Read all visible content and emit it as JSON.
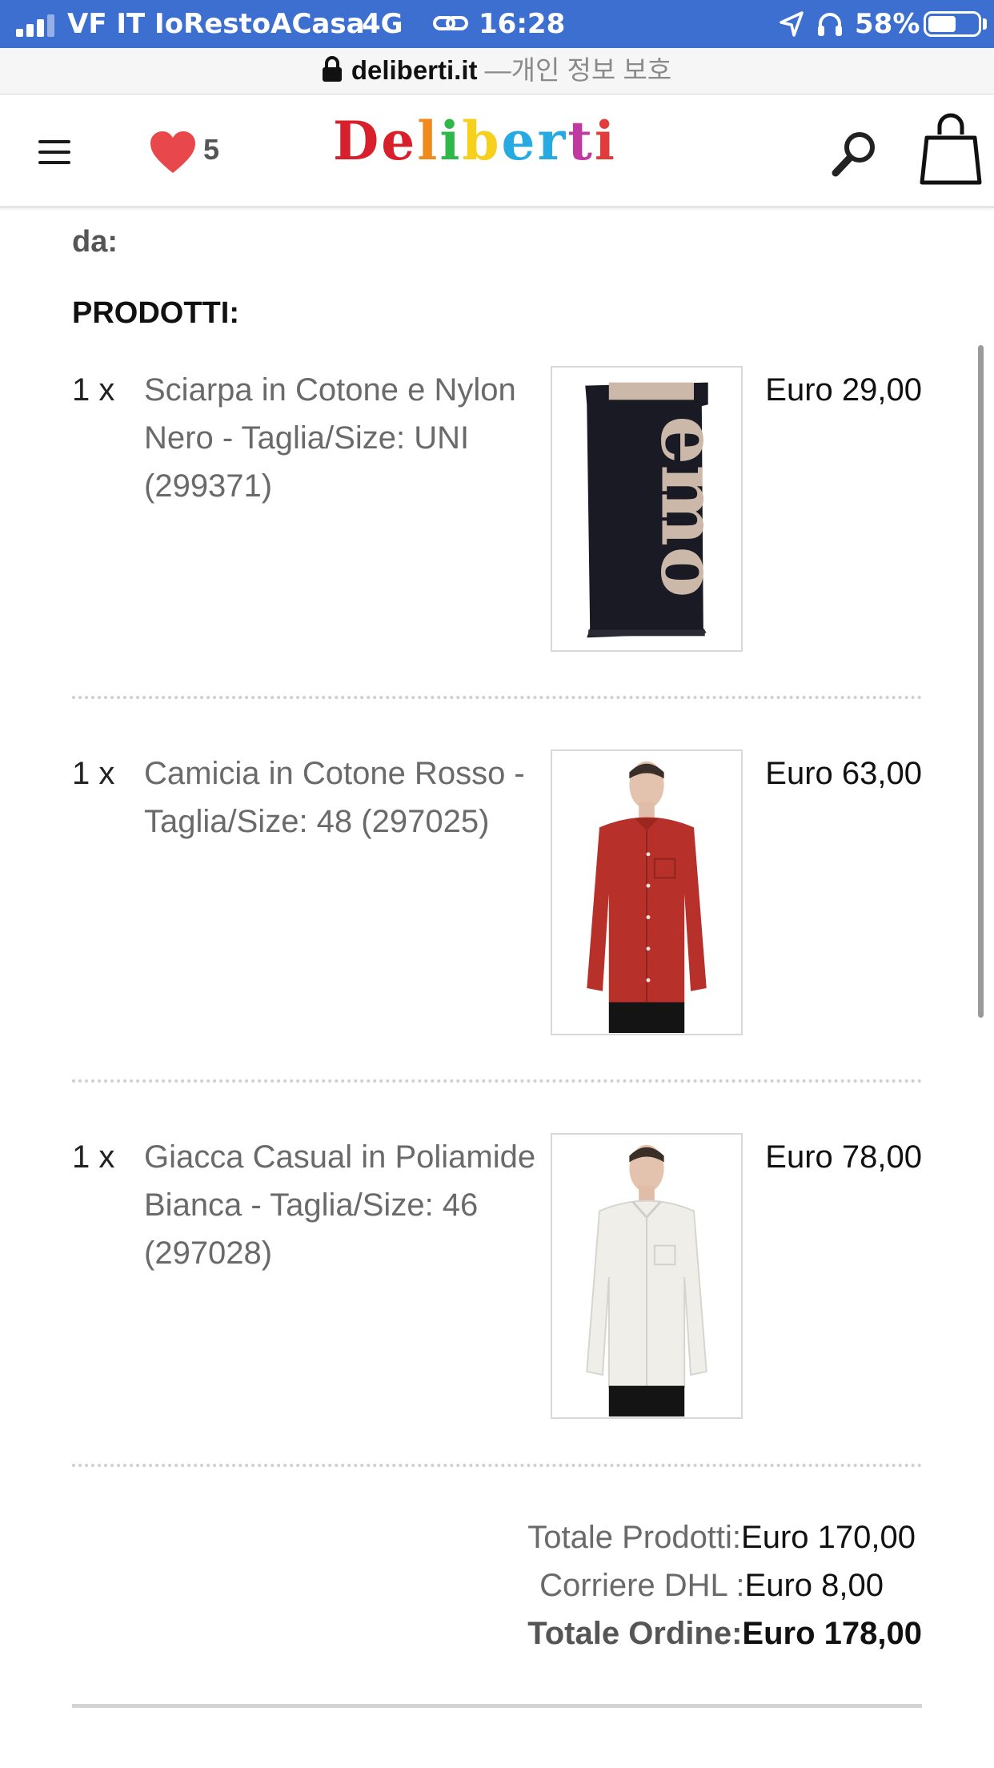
{
  "status_bar": {
    "carrier": "VF IT IoRestoACasa",
    "network": "4G",
    "time": "16:28",
    "battery_percent": "58%",
    "battery_level": 0.58
  },
  "url_bar": {
    "domain": "deliberti.it",
    "separator": "—",
    "privacy_label": "개인 정보 보호"
  },
  "header": {
    "logo": [
      "D",
      "e",
      "l",
      "i",
      "b",
      "e",
      "r",
      "t",
      "i"
    ],
    "logo_colors": [
      "#d8202c",
      "#d8202c",
      "#f08a1c",
      "#2eb84a",
      "#f7cf1d",
      "#27a9e1",
      "#27a9e1",
      "#c0399f",
      "#e33b3b"
    ],
    "wishlist_count": "5",
    "heart_color": "#e8474c"
  },
  "order": {
    "partial_label": "da:",
    "products_heading": "PRODOTTI:",
    "items": [
      {
        "qty": "1 x",
        "description": "Sciarpa in Cotone e Nylon Nero - Taglia/Size: UNI (299371)",
        "price": "Euro 29,00"
      },
      {
        "qty": "1 x",
        "description": "Camicia in Cotone Rosso - Taglia/Size: 48 (297025)",
        "price": "Euro 63,00"
      },
      {
        "qty": "1 x",
        "description": "Giacca Casual in Poliamide Bianca - Taglia/Size: 46 (297028)",
        "price": "Euro 78,00"
      }
    ],
    "totals": {
      "products_label": "Totale Prodotti:",
      "products_value": "Euro 170,00",
      "shipping_label": "Corriere DHL :",
      "shipping_value": "Euro 8,00",
      "order_label": "Totale Ordine:",
      "order_value": "Euro 178,00"
    }
  }
}
